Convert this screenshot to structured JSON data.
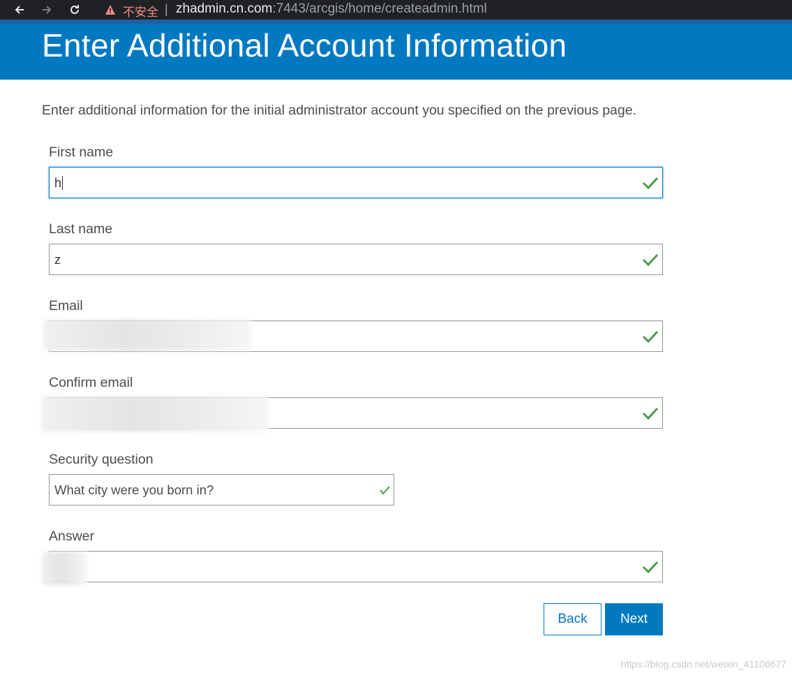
{
  "browser": {
    "insecure_label": "不安全",
    "separator": "|",
    "url_host": "zhadmin.cn.com",
    "url_rest": ":7443/arcgis/home/createadmin.html"
  },
  "page": {
    "title": "Enter Additional Account Information",
    "intro": "Enter additional information for the initial administrator account you specified on the previous page."
  },
  "form": {
    "first_name": {
      "label": "First name",
      "value": "h"
    },
    "last_name": {
      "label": "Last name",
      "value": "z"
    },
    "email": {
      "label": "Email"
    },
    "confirm_email": {
      "label": "Confirm email"
    },
    "security_question": {
      "label": "Security question",
      "value": "What city were you born in?"
    },
    "answer": {
      "label": "Answer"
    }
  },
  "buttons": {
    "back": "Back",
    "next": "Next"
  },
  "colors": {
    "accent": "#0079c1",
    "valid": "#4a9a4a"
  },
  "watermark": "https://blog.csdn.net/weixin_41106677"
}
